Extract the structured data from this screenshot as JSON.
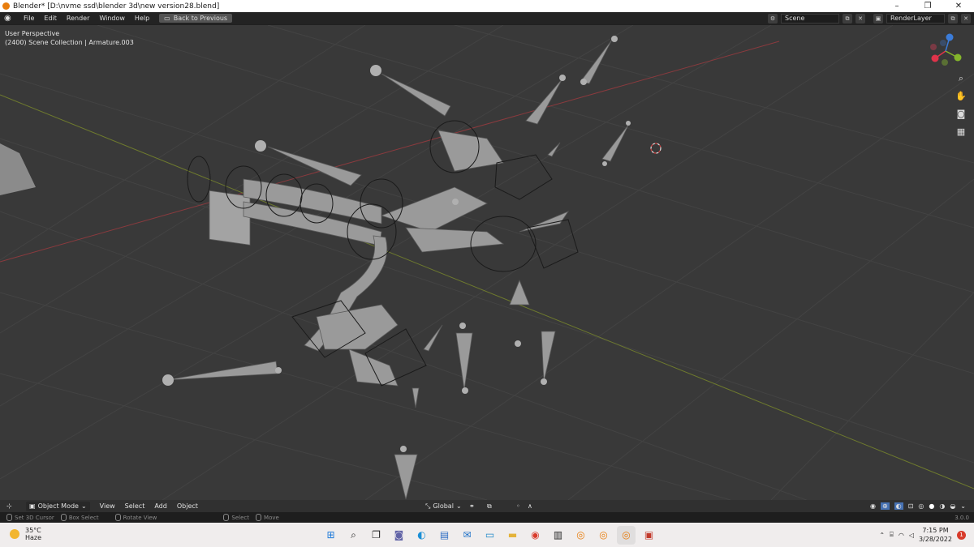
{
  "window": {
    "title": "Blender* [D:\\nvme ssd\\blender 3d\\new version28.blend]",
    "controls": [
      "–",
      "❐",
      "✕"
    ]
  },
  "topbar": {
    "menus": [
      "File",
      "Edit",
      "Render",
      "Window",
      "Help"
    ],
    "back_button": "Back to Previous",
    "scene_value": "Scene",
    "renderlayer_value": "RenderLayer"
  },
  "viewport": {
    "perspective_label": "User Perspective",
    "collection_label": "(2400) Scene Collection | Armature.003",
    "gizmo_colors": {
      "x": "#e0334a",
      "y": "#84b52b",
      "z": "#3b7cd9"
    }
  },
  "header3d": {
    "mode": "Object Mode",
    "menus": [
      "View",
      "Select",
      "Add",
      "Object"
    ],
    "transform_orientation": "Global"
  },
  "statusbar": {
    "items": [
      "Set 3D Cursor",
      "Box Select",
      "Rotate View",
      "Select",
      "Move"
    ],
    "version": "3.0.0"
  },
  "taskbar": {
    "weather_temp": "35°C",
    "weather_desc": "Haze",
    "time": "7:15 PM",
    "date": "3/28/2022",
    "notifications": "1"
  }
}
